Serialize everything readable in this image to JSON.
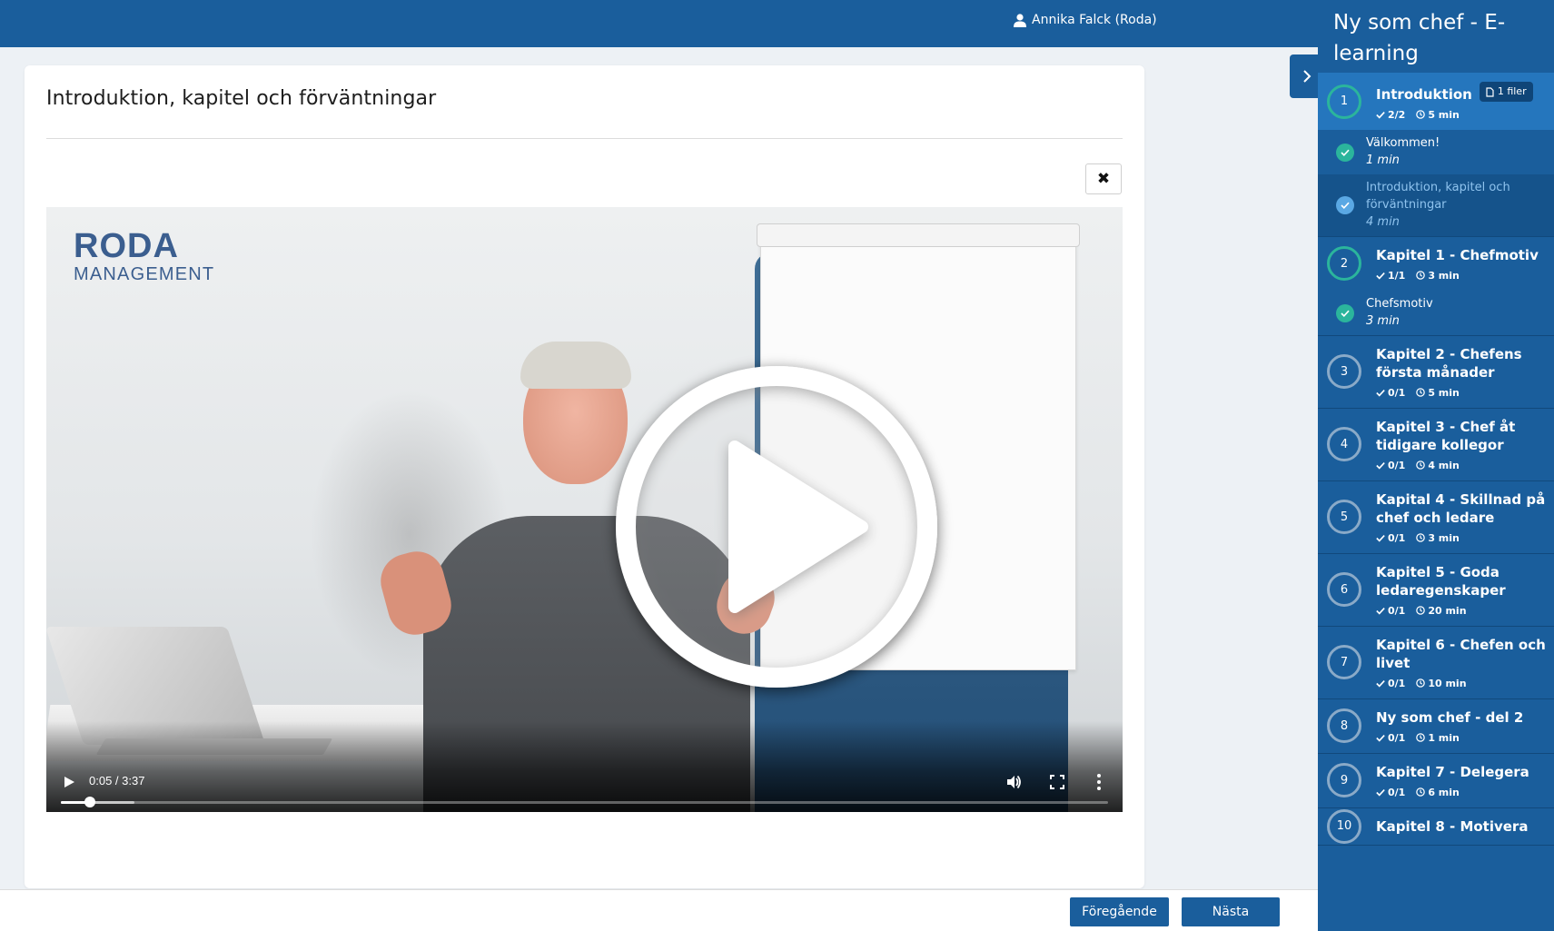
{
  "header": {
    "user_name": "Annika Falck (Roda)"
  },
  "content": {
    "title": "Introduktion, kapitel och förväntningar",
    "close_symbol": "✖",
    "video": {
      "logo_line1": "RODA",
      "logo_line2": "MANAGEMENT",
      "time": "0:05 / 3:37",
      "progress": 0.028,
      "buffered": 0.07
    }
  },
  "footer": {
    "prev_label": "Föregående",
    "next_label": "Nästa"
  },
  "sidebar": {
    "title": "Ny som chef - E-learning",
    "chapters": [
      {
        "num": "1",
        "title": "Introduktion",
        "badge": "1 filer",
        "progress": "2/2",
        "duration": "5 min",
        "done": true,
        "active": true,
        "lessons": [
          {
            "title": "Välkommen!",
            "duration": "1 min"
          },
          {
            "title": "Introduktion, kapitel och förväntningar",
            "duration": "4 min",
            "current": true
          }
        ]
      },
      {
        "num": "2",
        "title": "Kapitel 1 - Chefmotiv",
        "progress": "1/1",
        "duration": "3 min",
        "done": true,
        "lessons": [
          {
            "title": "Chefsmotiv",
            "duration": "3 min"
          }
        ]
      },
      {
        "num": "3",
        "title": "Kapitel 2 - Chefens första månader",
        "progress": "0/1",
        "duration": "5 min"
      },
      {
        "num": "4",
        "title": "Kapitel 3 - Chef åt tidigare kollegor",
        "progress": "0/1",
        "duration": "4 min"
      },
      {
        "num": "5",
        "title": "Kapital 4 - Skillnad på chef och ledare",
        "progress": "0/1",
        "duration": "3 min"
      },
      {
        "num": "6",
        "title": "Kapitel 5 - Goda ledaregenskaper",
        "progress": "0/1",
        "duration": "20 min"
      },
      {
        "num": "7",
        "title": "Kapitel 6 - Chefen och livet",
        "progress": "0/1",
        "duration": "10 min"
      },
      {
        "num": "8",
        "title": "Ny som chef - del 2",
        "progress": "0/1",
        "duration": "1 min"
      },
      {
        "num": "9",
        "title": "Kapitel 7 - Delegera",
        "progress": "0/1",
        "duration": "6 min"
      },
      {
        "num": "10",
        "title": "Kapitel 8 - Motivera",
        "progress": "",
        "duration": ""
      }
    ]
  },
  "colors": {
    "primary": "#1a5e9c",
    "active_chapter": "#2576bd",
    "done_ring": "#2bb59c",
    "current_lesson_text": "#8fc3ee"
  }
}
